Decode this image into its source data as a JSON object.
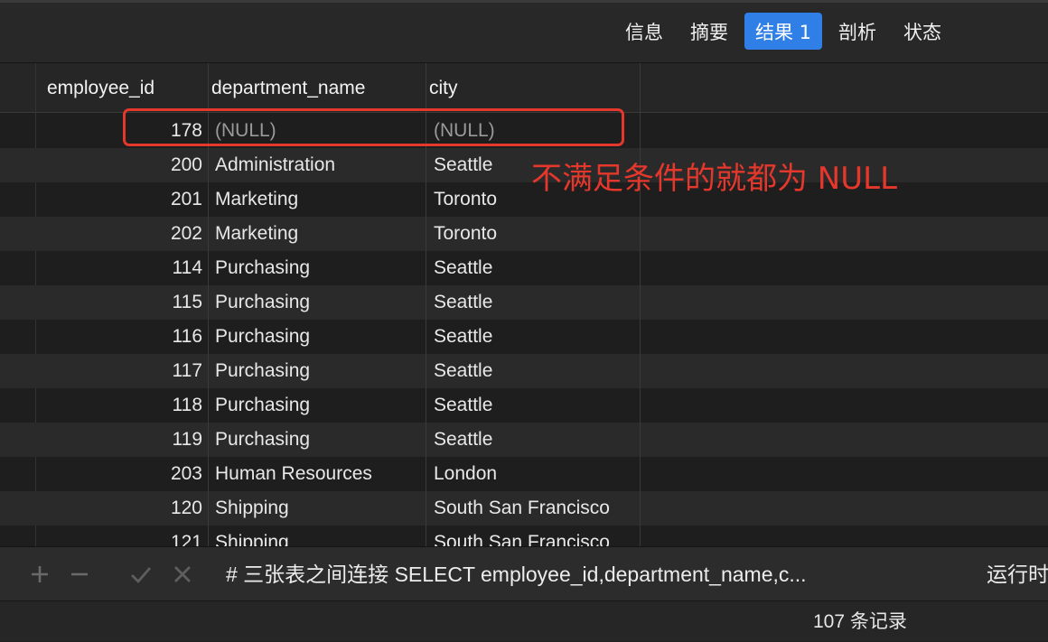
{
  "tabs": [
    {
      "label": "信息",
      "active": false
    },
    {
      "label": "摘要",
      "active": false
    },
    {
      "label": "结果 1",
      "active": true
    },
    {
      "label": "剖析",
      "active": false
    },
    {
      "label": "状态",
      "active": false
    }
  ],
  "columns": [
    "employee_id",
    "department_name",
    "city"
  ],
  "rows": [
    [
      "178",
      "(NULL)",
      "(NULL)"
    ],
    [
      "200",
      "Administration",
      "Seattle"
    ],
    [
      "201",
      "Marketing",
      "Toronto"
    ],
    [
      "202",
      "Marketing",
      "Toronto"
    ],
    [
      "114",
      "Purchasing",
      "Seattle"
    ],
    [
      "115",
      "Purchasing",
      "Seattle"
    ],
    [
      "116",
      "Purchasing",
      "Seattle"
    ],
    [
      "117",
      "Purchasing",
      "Seattle"
    ],
    [
      "118",
      "Purchasing",
      "Seattle"
    ],
    [
      "119",
      "Purchasing",
      "Seattle"
    ],
    [
      "203",
      "Human Resources",
      "London"
    ],
    [
      "120",
      "Shipping",
      "South San Francisco"
    ],
    [
      "121",
      "Shipping",
      "South San Francisco"
    ]
  ],
  "annotation": "不满足条件的就都为 NULL",
  "colors": {
    "accent": "#2f7fe6",
    "annotation": "#e5372b"
  },
  "toolbar": {
    "icons": [
      "plus-icon",
      "minus-icon",
      "check-icon",
      "cross-icon"
    ],
    "sql": "# 三张表之间连接 SELECT employee_id,department_name,c...",
    "run_label": "运行时"
  },
  "status": {
    "record_count": "107 条记录"
  }
}
